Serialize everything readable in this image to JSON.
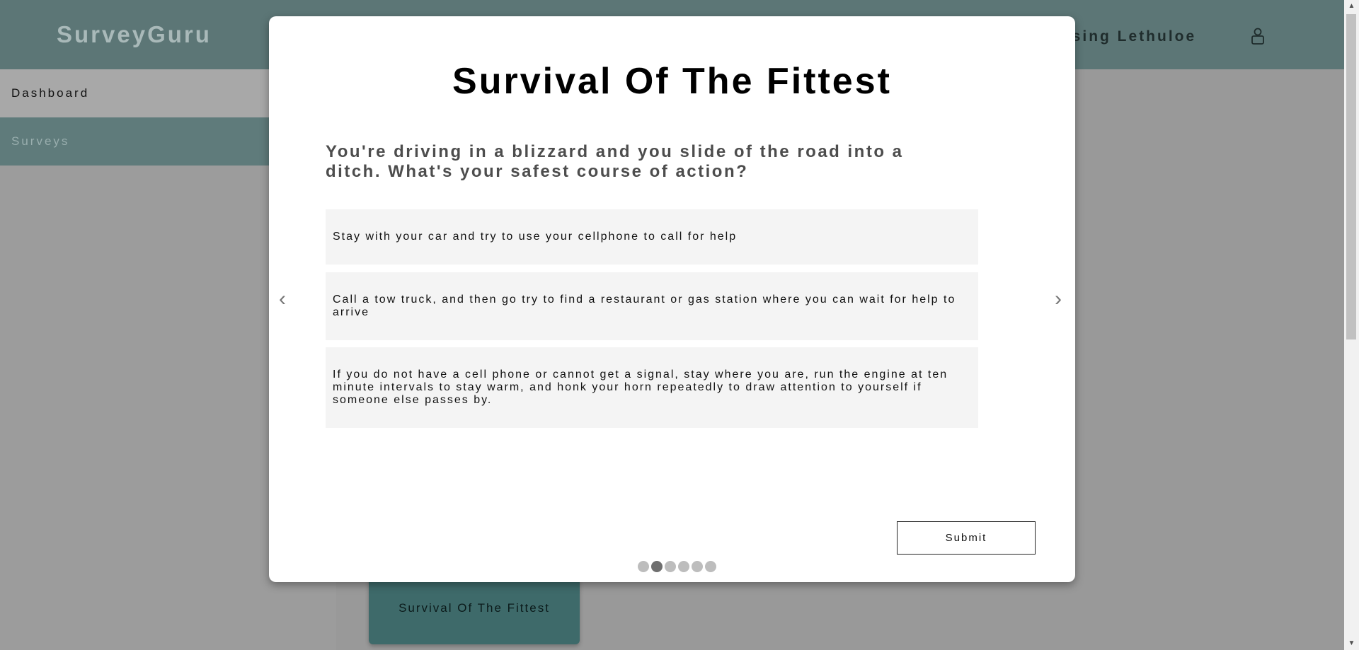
{
  "header": {
    "brand": "SurveyGuru",
    "user_name_visible": "ssing Lethuloe",
    "user_icon": "user-icon"
  },
  "sidebar": {
    "items": [
      {
        "label": "Dashboard",
        "active": false
      },
      {
        "label": "Surveys",
        "active": true
      }
    ]
  },
  "main": {
    "survey_card_label": "Survival Of The Fittest"
  },
  "modal": {
    "title": "Survival Of The Fittest",
    "question": "You're driving in a blizzard and you slide of the road into a ditch. What's your safest course of action?",
    "options": [
      "Stay with your car and try to use your cellphone to call for help",
      "Call a tow truck, and then go try to find a restaurant or gas station where you can wait for help to arrive",
      "If you do not have a cell phone or cannot get a signal, stay where you are, run the engine at ten minute intervals to stay warm, and honk your horn repeatedly to draw attention to yourself if someone else passes by."
    ],
    "prev_symbol": "‹",
    "next_symbol": "›",
    "submit_label": "Submit",
    "pagination": {
      "total": 6,
      "current": 2
    }
  },
  "colors": {
    "header_bg": "#5c7676",
    "active_sidebar_bg": "#5f7b7b",
    "card_bg": "#3e6a6a",
    "overlay_bg": "#9c9c9c",
    "option_bg": "#f4f4f4"
  }
}
